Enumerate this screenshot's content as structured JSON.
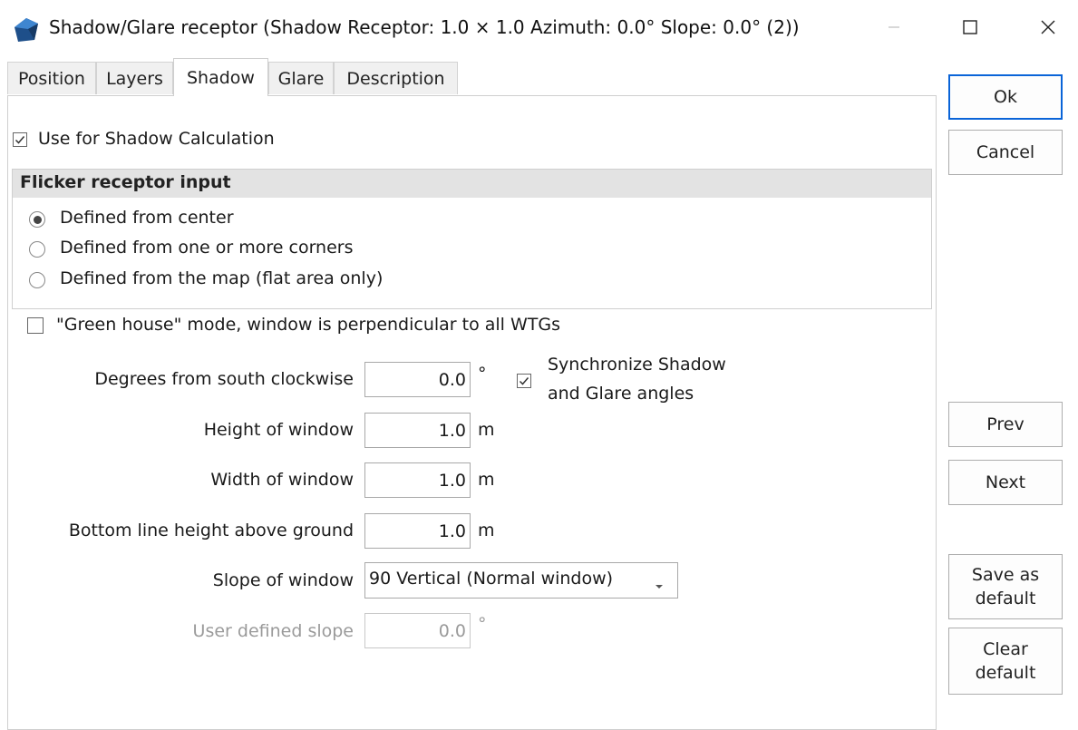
{
  "window": {
    "title": "Shadow/Glare receptor   (Shadow Receptor: 1.0 × 1.0  Azimuth: 0.0°  Slope: 0.0° (2))",
    "icon": "receptor-app-icon",
    "minimize_icon": "minimize-icon",
    "maximize_icon": "maximize-icon",
    "close_icon": "close-icon"
  },
  "tabs": [
    {
      "label": "Position",
      "active": false
    },
    {
      "label": "Layers",
      "active": false
    },
    {
      "label": "Shadow",
      "active": true
    },
    {
      "label": "Glare",
      "active": false
    },
    {
      "label": "Description",
      "active": false
    }
  ],
  "shadow": {
    "use_for_shadow": {
      "label": "Use for Shadow Calculation",
      "checked": true
    },
    "flicker_group": {
      "title": "Flicker receptor input",
      "options": [
        {
          "label": "Defined from center",
          "selected": true
        },
        {
          "label": "Defined from one or more corners",
          "selected": false
        },
        {
          "label": "Defined from the map (flat area only)",
          "selected": false
        }
      ]
    },
    "green_house": {
      "label": "\"Green house\" mode, window is perpendicular to all WTGs",
      "checked": false
    },
    "degrees": {
      "label": "Degrees from south clockwise",
      "value": "0.0",
      "unit": "°"
    },
    "sync": {
      "line1": "Synchronize Shadow",
      "line2": "and Glare angles",
      "checked": true
    },
    "height": {
      "label": "Height of window",
      "value": "1.0",
      "unit": "m"
    },
    "width": {
      "label": "Width of window",
      "value": "1.0",
      "unit": "m"
    },
    "bottom": {
      "label": "Bottom line height above ground",
      "value": "1.0",
      "unit": "m"
    },
    "slope": {
      "label": "Slope of window",
      "value": "90 Vertical (Normal window)"
    },
    "user_slope": {
      "label": "User defined slope",
      "value": "0.0",
      "unit": "°",
      "disabled": true
    }
  },
  "buttons": {
    "ok": "Ok",
    "cancel": "Cancel",
    "prev": "Prev",
    "next": "Next",
    "save_default_1": "Save as",
    "save_default_2": "default",
    "clear_default_1": "Clear",
    "clear_default_2": "default"
  },
  "colors": {
    "accent_border": "#0a64d8",
    "group_header_bg": "#e3e3e3",
    "disabled_text": "#9a9a9a"
  }
}
